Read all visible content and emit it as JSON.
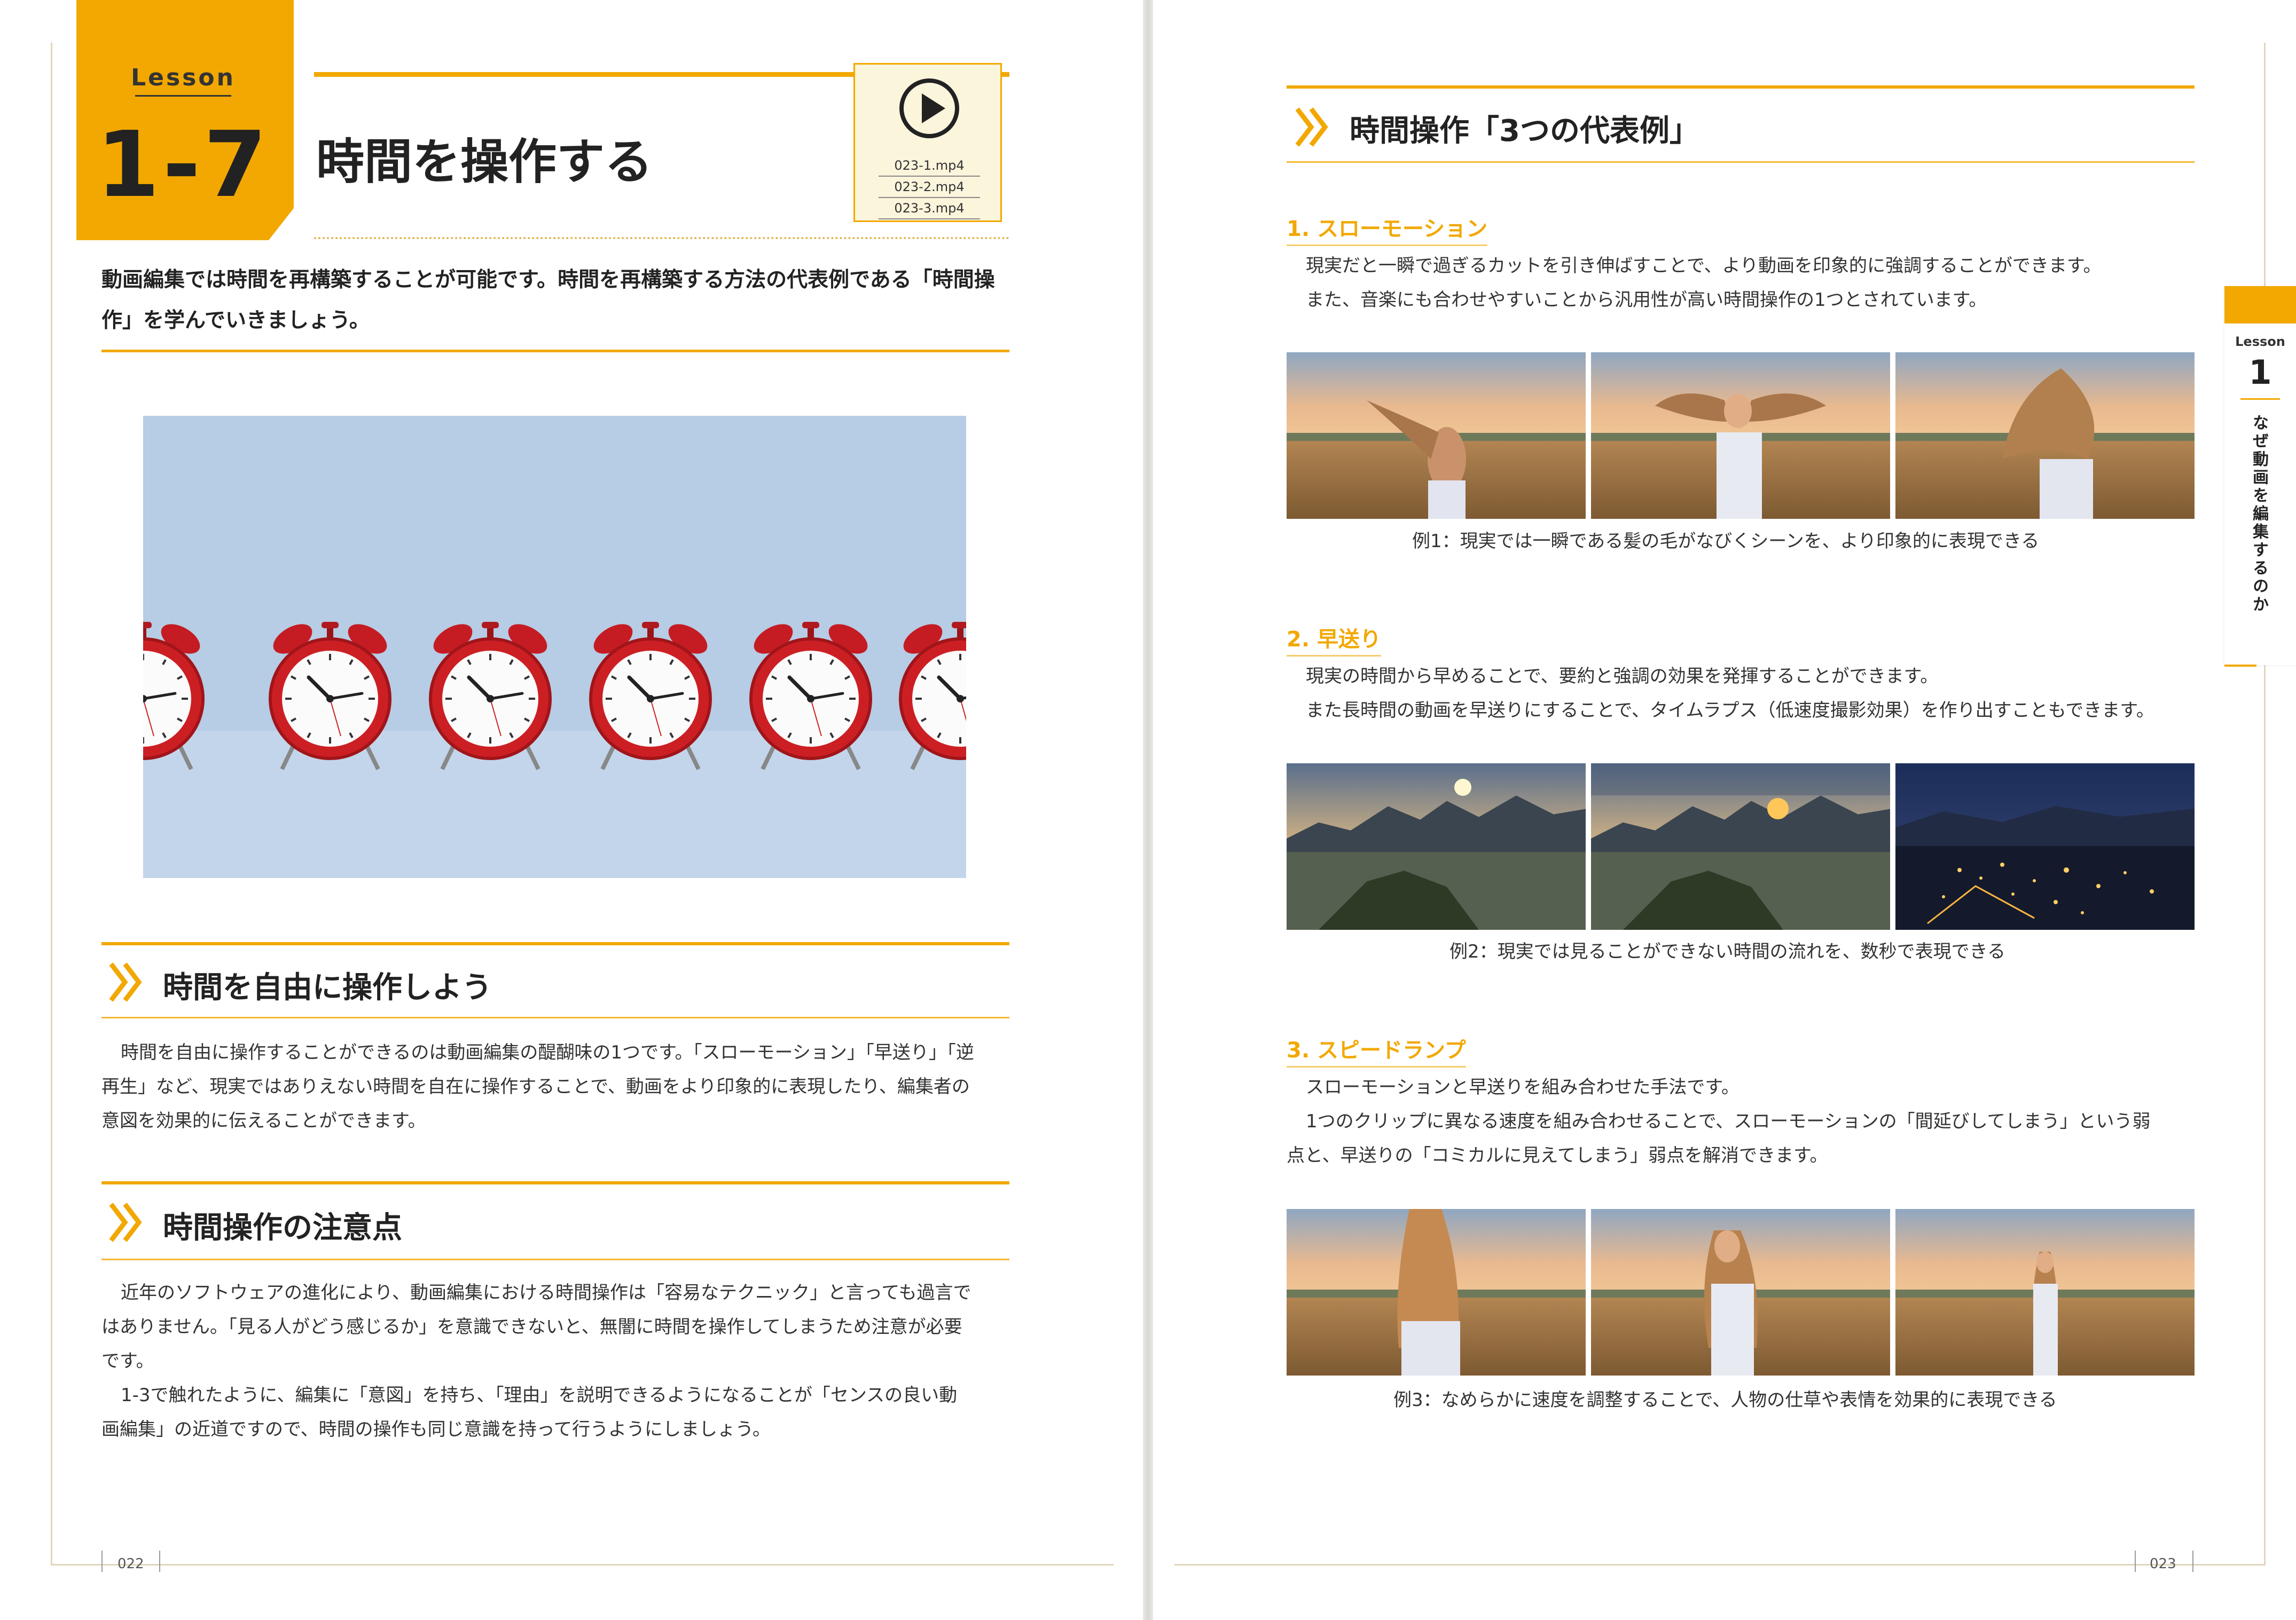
{
  "left_page": {
    "lesson_label": "Lesson",
    "lesson_number": "1-7",
    "title": "時間を操作する",
    "video_files": [
      "023-1.mp4",
      "023-2.mp4",
      "023-3.mp4"
    ],
    "intro": [
      "動画編集では時間を再構築することが可能です。時間を再構築する方法の代表例である「時間操",
      "作」を学んでいきましょう。"
    ],
    "section1": {
      "heading": "時間を自由に操作しよう",
      "lines": [
        "時間を自由に操作することができるのは動画編集の醍醐味の1つです。「スローモーション」「早送り」「逆",
        "再生」など、現実ではありえない時間を自在に操作することで、動画をより印象的に表現したり、編集者の",
        "意図を効果的に伝えることができます。"
      ]
    },
    "section2": {
      "heading": "時間操作の注意点",
      "lines": [
        "近年のソフトウェアの進化により、動画編集における時間操作は「容易なテクニック」と言っても過言で",
        "はありません。「見る人がどう感じるか」を意識できないと、無闇に時間を操作してしまうため注意が必要",
        "です。",
        "1-3で触れたように、編集に「意図」を持ち、「理由」を説明できるようになることが「センスの良い動",
        "画編集」の近道ですので、時間の操作も同じ意識を持って行うようにしましょう。"
      ]
    },
    "page_number": "022"
  },
  "right_page": {
    "heading": "時間操作「3つの代表例」",
    "examples": [
      {
        "title": "1. スローモーション",
        "lines": [
          "現実だと一瞬で過ぎるカットを引き伸ばすことで、より動画を印象的に強調することができます。",
          "また、音楽にも合わせやすいことから汎用性が高い時間操作の1つとされています。"
        ],
        "caption": "例1：現実では一瞬である髪の毛がなびくシーンを、より印象的に表現できる"
      },
      {
        "title": "2. 早送り",
        "lines": [
          "現実の時間から早めることで、要約と強調の効果を発揮することができます。",
          "また長時間の動画を早送りにすることで、タイムラプス（低速度撮影効果）を作り出すこともできます。"
        ],
        "caption": "例2：現実では見ることができない時間の流れを、数秒で表現できる"
      },
      {
        "title": "3. スピードランプ",
        "lines": [
          "スローモーションと早送りを組み合わせた手法です。",
          "1つのクリップに異なる速度を組み合わせることで、スローモーションの「間延びしてしまう」という弱",
          "点と、早送りの「コミカルに見えてしまう」弱点を解消できます。"
        ],
        "caption": "例3：なめらかに速度を調整することで、人物の仕草や表情を効果的に表現できる"
      }
    ],
    "side_tab": {
      "label": "Lesson",
      "number": "1",
      "text": "なぜ動画を編集するのか"
    },
    "page_number": "023"
  },
  "colors": {
    "accent": "#f2a800",
    "accent_light": "#f5b731",
    "sky_blue": "#b8cde6",
    "clock_red": "#cc1f24"
  }
}
